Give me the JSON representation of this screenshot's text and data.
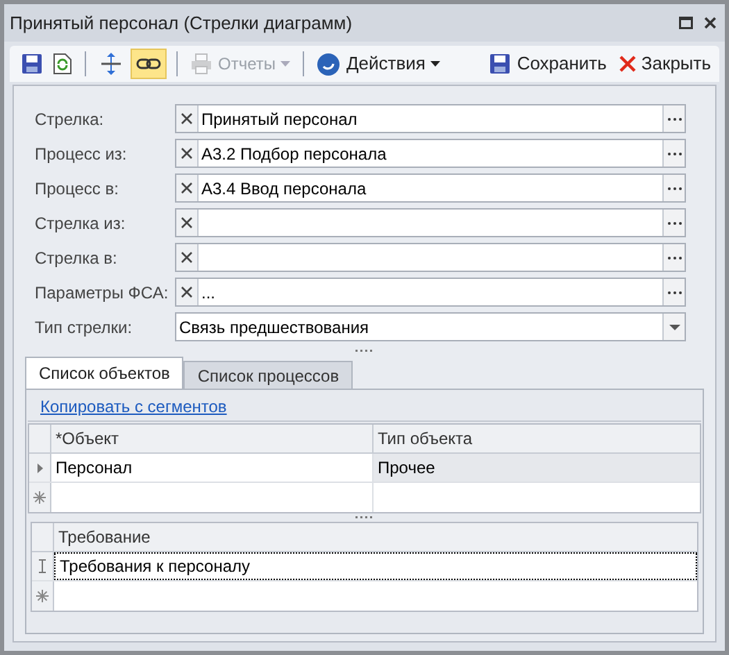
{
  "window": {
    "title": "Принятый персонал (Стрелки диаграмм)"
  },
  "toolbar": {
    "link_toggle": {
      "selected": true
    },
    "reports": {
      "label": "Отчеты",
      "disabled": true
    },
    "actions": {
      "label": "Действия"
    },
    "save": {
      "label": "Сохранить"
    },
    "close": {
      "label": "Закрыть"
    }
  },
  "fields": [
    {
      "label": "Стрелка:",
      "kind": "lookup",
      "value": "Принятый персонал"
    },
    {
      "label": "Процесс из:",
      "kind": "lookup",
      "value": "А3.2 Подбор персонала"
    },
    {
      "label": "Процесс в:",
      "kind": "lookup",
      "value": "А3.4 Ввод персонала"
    },
    {
      "label": "Стрелка из:",
      "kind": "lookup"
    },
    {
      "label": "Стрелка в:",
      "kind": "lookup"
    },
    {
      "label": "Параметры ФСА:",
      "kind": "lookup",
      "value": "..."
    },
    {
      "label": "Тип стрелки:",
      "kind": "dropdown",
      "value": "Связь предшествования"
    }
  ],
  "tabs": [
    {
      "label": "Список объектов",
      "selected": true
    },
    {
      "label": "Список процессов",
      "selected": false
    }
  ],
  "link": "Копировать с сегментов",
  "objects_table": {
    "columns": [
      "*Объект",
      "Тип объекта"
    ],
    "rows": [
      {
        "cells": [
          "Персонал",
          "Прочее"
        ],
        "selected": true
      }
    ]
  },
  "requirements_table": {
    "columns": [
      "Требование"
    ],
    "rows": [
      {
        "cells": [
          "Требования к персоналу"
        ],
        "editing": true
      }
    ]
  }
}
